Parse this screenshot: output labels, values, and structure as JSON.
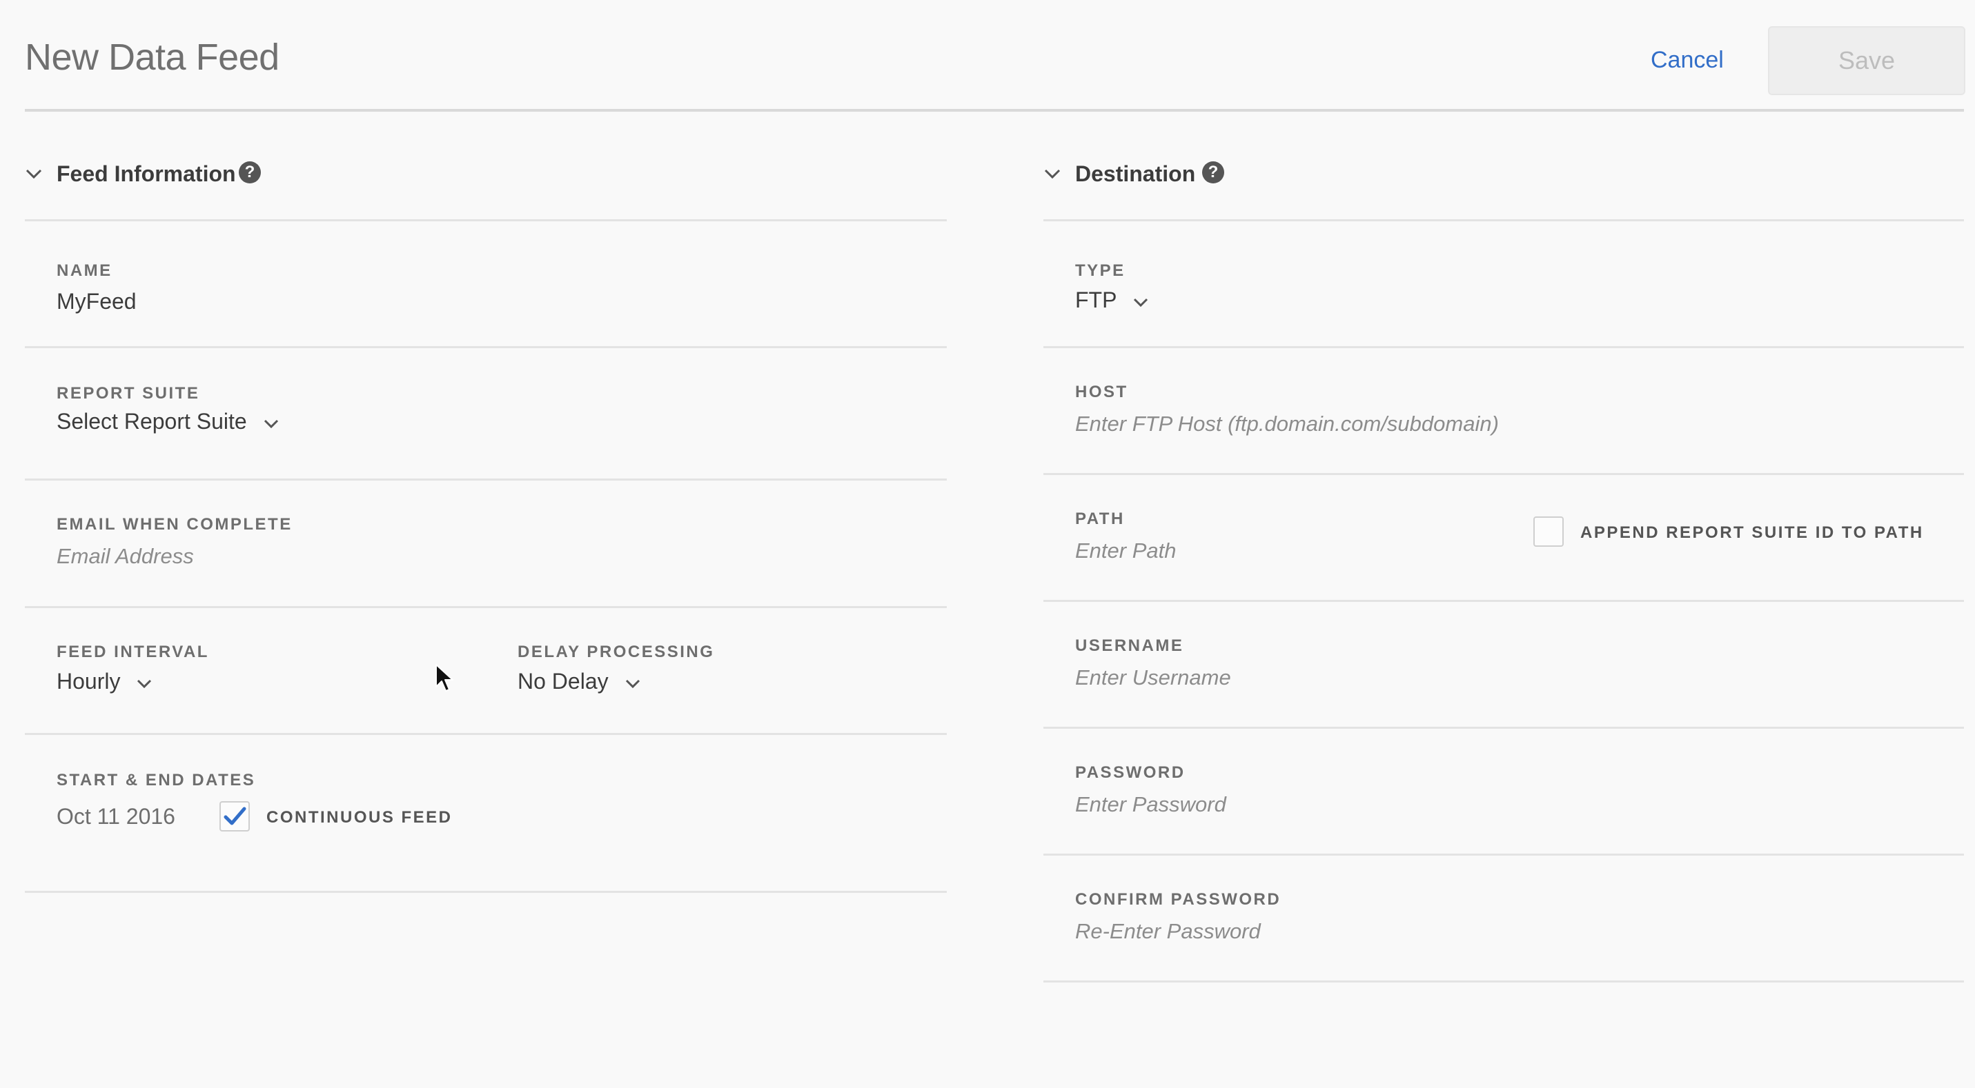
{
  "header": {
    "title": "New Data Feed",
    "cancel_label": "Cancel",
    "save_label": "Save"
  },
  "feed_information": {
    "title": "Feed Information",
    "help_glyph": "?",
    "name": {
      "label": "NAME",
      "value": "MyFeed"
    },
    "report_suite": {
      "label": "REPORT SUITE",
      "value": "Select Report Suite"
    },
    "email": {
      "label": "EMAIL WHEN COMPLETE",
      "placeholder": "Email Address"
    },
    "feed_interval": {
      "label": "FEED INTERVAL",
      "value": "Hourly"
    },
    "delay_processing": {
      "label": "DELAY PROCESSING",
      "value": "No Delay"
    },
    "dates": {
      "label": "START & END DATES",
      "start_date": "Oct 11 2016",
      "continuous_feed_label": "CONTINUOUS FEED",
      "continuous_feed_checked": true
    }
  },
  "destination": {
    "title": "Destination",
    "help_glyph": "?",
    "type": {
      "label": "TYPE",
      "value": "FTP"
    },
    "host": {
      "label": "HOST",
      "placeholder": "Enter FTP Host (ftp.domain.com/subdomain)"
    },
    "path": {
      "label": "PATH",
      "placeholder": "Enter Path",
      "append_label": "APPEND REPORT SUITE ID TO PATH",
      "append_checked": false
    },
    "username": {
      "label": "USERNAME",
      "placeholder": "Enter Username"
    },
    "password": {
      "label": "PASSWORD",
      "placeholder": "Enter Password"
    },
    "confirm_password": {
      "label": "CONFIRM PASSWORD",
      "placeholder": "Re-Enter Password"
    }
  },
  "colors": {
    "background": "#f9f9f9",
    "link": "#326ec8",
    "checkmark": "#326ec8",
    "divider": "#e3e3e3"
  },
  "icons": {
    "collapse": "chevron-down-icon",
    "help": "help-circle-icon",
    "dropdown": "chevron-down-icon",
    "check": "checkmark-icon",
    "cursor": "mouse-pointer-icon"
  }
}
